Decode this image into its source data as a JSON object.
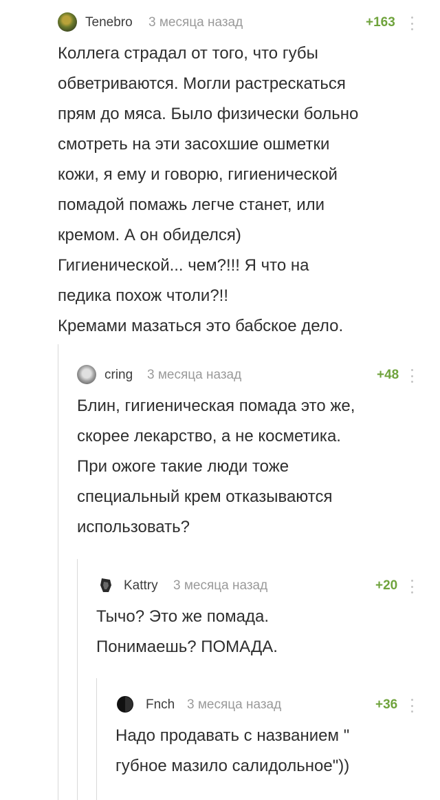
{
  "comments": [
    {
      "username": "Tenebro",
      "time": "3 месяца назад",
      "rating": "+163",
      "text": [
        "Коллега страдал от того, что губы",
        "обветриваются. Могли растрескаться",
        "прям до мяса. Было физически больно",
        "смотреть на эти засохшие ошметки",
        "кожи, я ему и говорю, гигиенической",
        "помадой помажь легче станет, или",
        "кремом. А он обиделся)",
        "Гигиенической... чем?!!! Я что на",
        "педика похож чтоли?!!",
        "Кремами мазаться это бабское дело."
      ]
    },
    {
      "username": "cring",
      "time": "3 месяца назад",
      "rating": "+48",
      "text": [
        "Блин, гигиеническая помада это же,",
        "скорее лекарство, а не косметика.",
        "При ожоге такие люди тоже",
        "специальный крем отказываются",
        "использовать?"
      ]
    },
    {
      "username": "Kattry",
      "time": "3 месяца назад",
      "rating": "+20",
      "text": [
        "Тычо? Это же помада.",
        "Понимаешь? ПОМАДА."
      ]
    },
    {
      "username": "Fnch",
      "time": "3 месяца назад",
      "rating": "+36",
      "text": [
        "Надо продавать с названием \"",
        "губное мазило салидольное\"))"
      ]
    }
  ]
}
